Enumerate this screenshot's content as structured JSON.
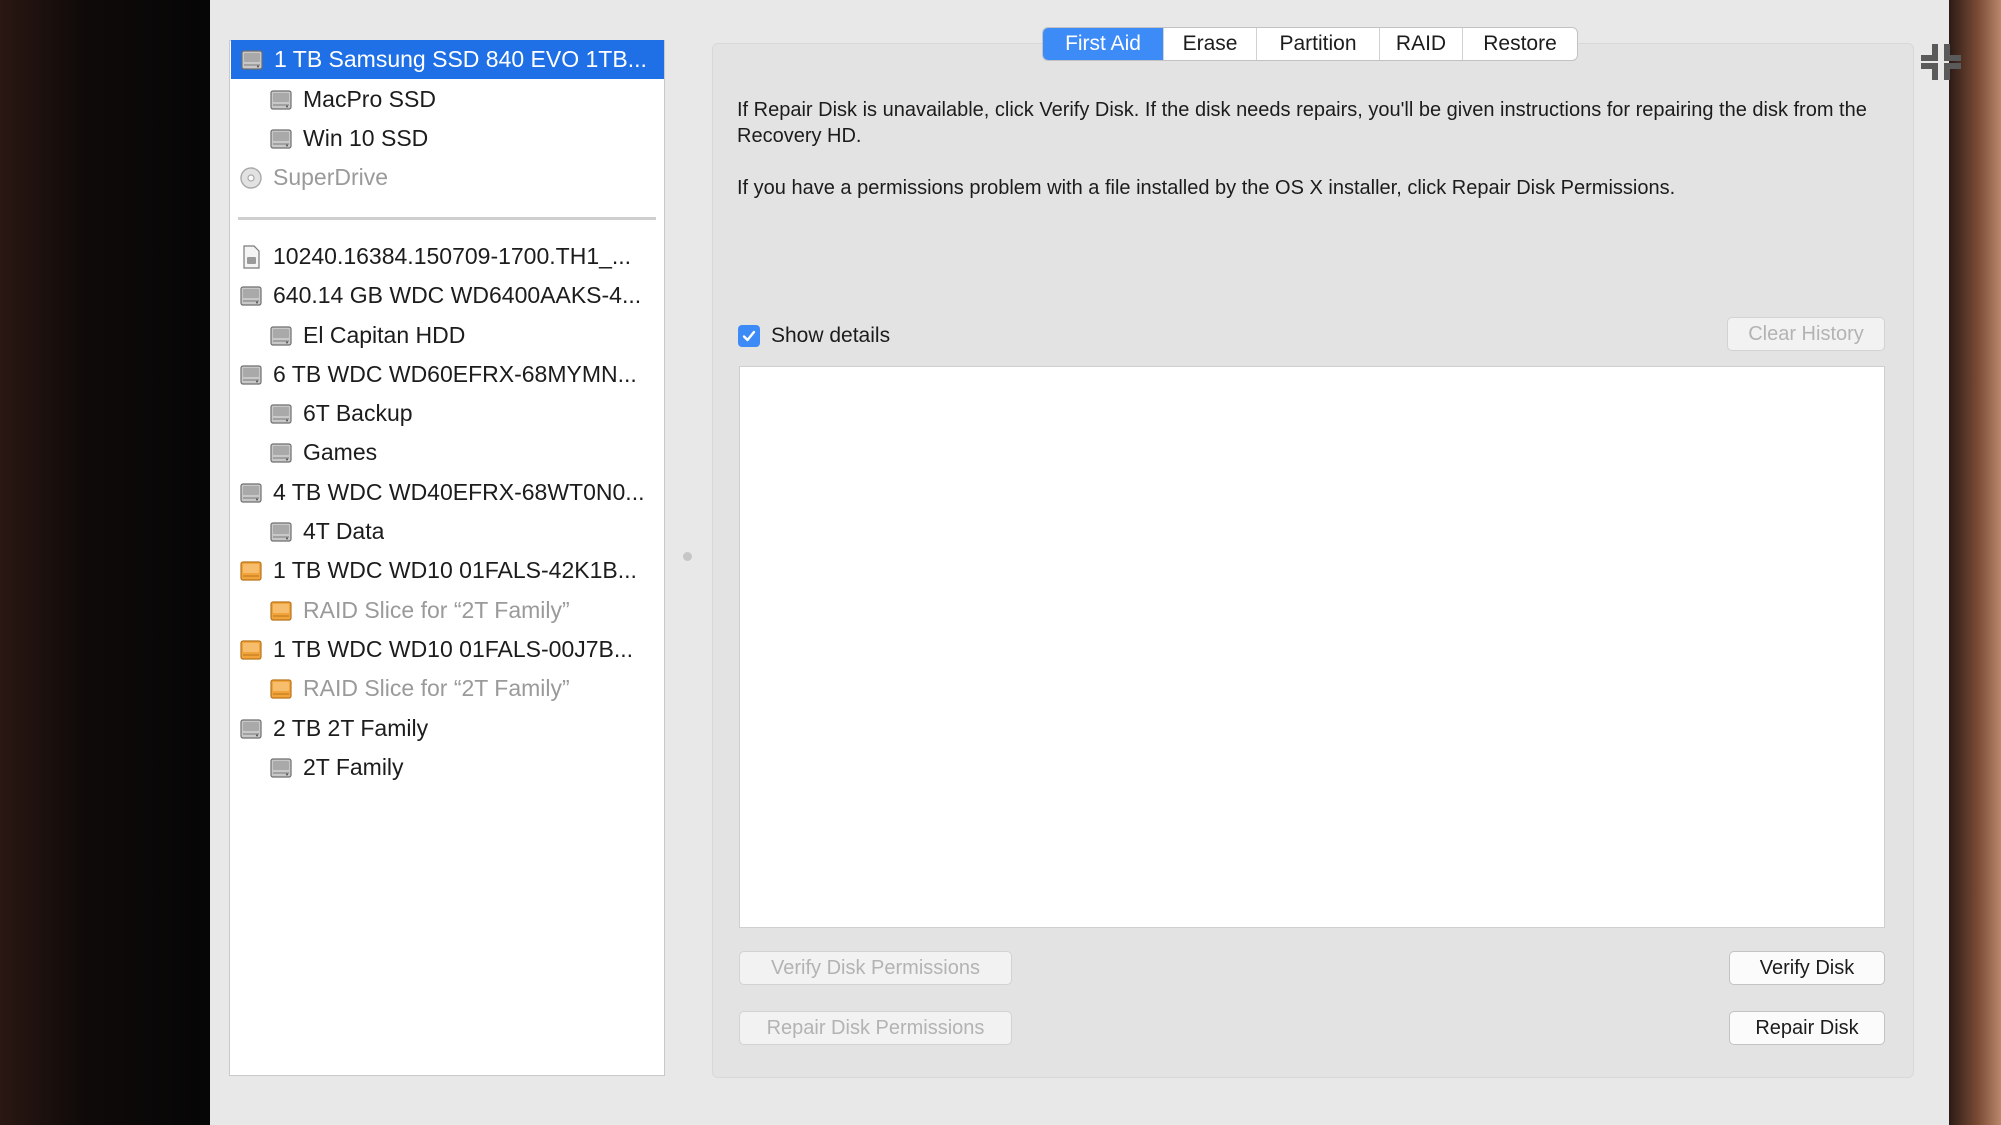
{
  "tabs": [
    {
      "label": "First Aid",
      "active": true
    },
    {
      "label": "Erase",
      "active": false
    },
    {
      "label": "Partition",
      "active": false
    },
    {
      "label": "RAID",
      "active": false
    },
    {
      "label": "Restore",
      "active": false
    }
  ],
  "sidebar": {
    "items": [
      {
        "label": "1 TB Samsung SSD 840 EVO 1TB...",
        "icon": "internal-disk-icon",
        "level": 0,
        "selected": true
      },
      {
        "label": "MacPro SSD",
        "icon": "volume-icon",
        "level": 1
      },
      {
        "label": "Win 10 SSD",
        "icon": "volume-icon",
        "level": 1
      },
      {
        "label": "SuperDrive",
        "icon": "optical-drive-icon",
        "level": 0,
        "disabled": true
      },
      {
        "label": "10240.16384.150709-1700.TH1_...",
        "icon": "disk-image-icon",
        "level": 0
      },
      {
        "label": "640.14 GB WDC WD6400AAKS-4...",
        "icon": "internal-disk-icon",
        "level": 0
      },
      {
        "label": "El Capitan HDD",
        "icon": "volume-icon",
        "level": 1
      },
      {
        "label": "6 TB WDC WD60EFRX-68MYMN...",
        "icon": "internal-disk-icon",
        "level": 0
      },
      {
        "label": "6T Backup",
        "icon": "volume-icon",
        "level": 1
      },
      {
        "label": "Games",
        "icon": "volume-icon",
        "level": 1
      },
      {
        "label": "4 TB WDC WD40EFRX-68WT0N0...",
        "icon": "internal-disk-icon",
        "level": 0
      },
      {
        "label": "4T Data",
        "icon": "volume-icon",
        "level": 1
      },
      {
        "label": "1 TB WDC WD10 01FALS-42K1B...",
        "icon": "raid-disk-icon",
        "level": 0
      },
      {
        "label": "RAID Slice for “2T Family”",
        "icon": "raid-slice-icon",
        "level": 1,
        "disabled": true
      },
      {
        "label": "1 TB WDC WD10 01FALS-00J7B...",
        "icon": "raid-disk-icon",
        "level": 0
      },
      {
        "label": "RAID Slice for “2T Family”",
        "icon": "raid-slice-icon",
        "level": 1,
        "disabled": true
      },
      {
        "label": "2 TB 2T Family",
        "icon": "raid-set-icon",
        "level": 0
      },
      {
        "label": "2T Family",
        "icon": "volume-icon",
        "level": 1
      }
    ]
  },
  "first_aid": {
    "info_1": "If Repair Disk is unavailable, click Verify Disk. If the disk needs repairs, you'll be given instructions for repairing the disk from the Recovery HD.",
    "info_2": "If you have a permissions problem with a file installed by the OS X installer, click Repair Disk Permissions.",
    "show_details_label": "Show details",
    "show_details_checked": true,
    "clear_history_label": "Clear History",
    "verify_permissions_label": "Verify Disk Permissions",
    "repair_permissions_label": "Repair Disk Permissions",
    "verify_disk_label": "Verify Disk",
    "repair_disk_label": "Repair Disk"
  },
  "colors": {
    "selection": "#1f6fe6",
    "accent": "#3d8bf7",
    "raid_orange": "#f2a33a"
  }
}
